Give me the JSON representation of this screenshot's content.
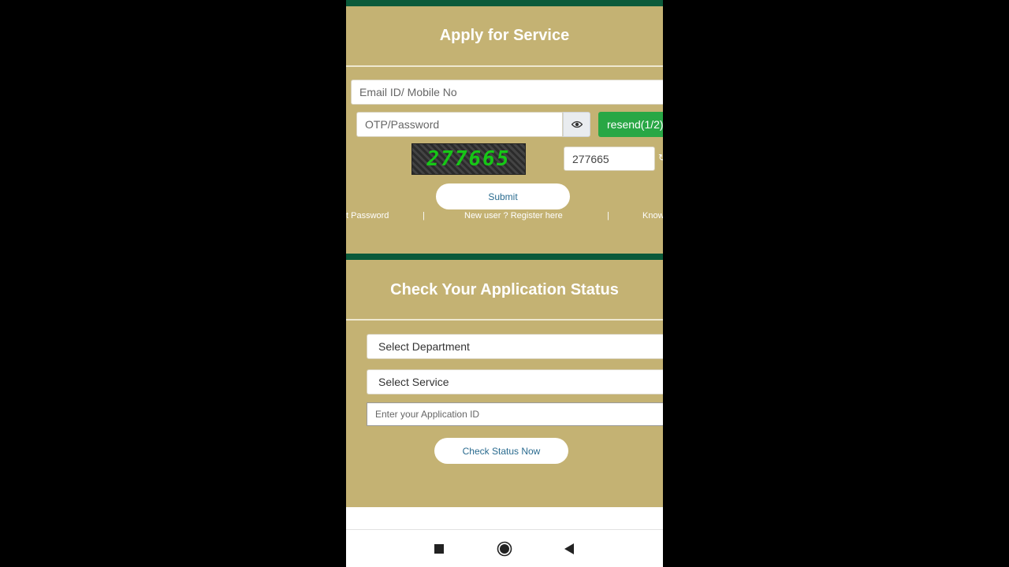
{
  "apply_panel": {
    "title": "Apply for Service",
    "email_placeholder": "Email ID/ Mobile No",
    "otp_placeholder": "OTP/Password",
    "resend_label": "resend(1/2)",
    "captcha_text": "277665",
    "captcha_input_value": "277665",
    "submit_label": "Submit",
    "forgot_password_link": "t Password",
    "separator": "|",
    "register_link": "New user ? Register here",
    "know_link": "Know"
  },
  "status_panel": {
    "title": "Check Your Application Status",
    "department_select": "Select Department",
    "service_select": "Select Service",
    "application_id_placeholder": "Enter your Application ID",
    "check_button_label": "Check Status Now"
  },
  "navigation": {
    "icons": [
      "recent-apps-icon",
      "home-icon",
      "back-icon"
    ]
  },
  "colors": {
    "panel_background": "#c4b273",
    "panel_top_bar": "#0b5a3a",
    "resend_button": "#28a745",
    "captcha_digits": "#16c716",
    "link_text": "#2a6b8f"
  }
}
